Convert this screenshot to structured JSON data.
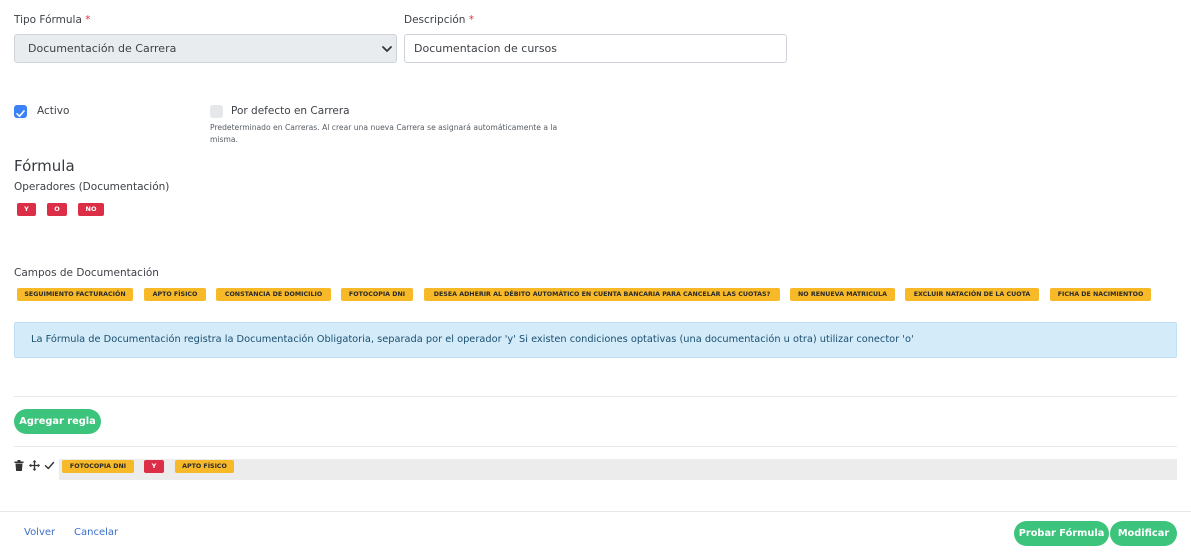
{
  "form": {
    "tipo_label": "Tipo Fórmula",
    "tipo_value": "Documentación de Carrera",
    "descripcion_label": "Descripción",
    "descripcion_value": "Documentacion de cursos",
    "required_mark": "*"
  },
  "options": {
    "activo_label": "Activo",
    "activo_checked": true,
    "por_defecto_label": "Por defecto en Carrera",
    "por_defecto_checked": false,
    "por_defecto_help_1": "Predeterminado en Carreras. Al crear una nueva Carrera se asignará automáticamente a la",
    "por_defecto_help_2": "misma."
  },
  "formula": {
    "heading": "Fórmula",
    "operators_label": "Operadores (Documentación)",
    "operators": [
      "Y",
      "O",
      "NO"
    ],
    "fields_label": "Campos de Documentación",
    "fields": [
      "SEGUIMIENTO FACTURACIÓN",
      "APTO FÍSICO",
      "CONSTANCIA DE DOMICILIO",
      "FOTOCOPIA DNI",
      "DESEA ADHERIR AL DÉBITO AUTOMÁTICO EN CUENTA BANCARIA PARA CANCELAR LAS CUOTAS?",
      "NO RENUEVA MATRICULA",
      "EXCLUIR NATACIÓN DE LA CUOTA",
      "FICHA DE NACIMIENTOO"
    ],
    "info_text": "La Fórmula de Documentación registra la Documentación Obligatoria, separada por el operador 'y' Si existen condiciones optativas (una documentación u otra) utilizar conector 'o'"
  },
  "rules": {
    "add_button": "Agregar regla",
    "rule_tokens": [
      {
        "text": "FOTOCOPIA DNI",
        "kind": "field"
      },
      {
        "text": "Y",
        "kind": "operator"
      },
      {
        "text": "APTO FÍSICO",
        "kind": "field"
      }
    ],
    "icons": [
      "trash-icon",
      "move-icon",
      "check-icon"
    ]
  },
  "footer": {
    "volver": "Volver",
    "cancelar": "Cancelar",
    "probar": "Probar Fórmula",
    "modificar": "Modificar"
  },
  "colors": {
    "operator": "#dc2e46",
    "field": "#f7b928",
    "accent_green": "#3cc47c",
    "checkbox_on": "#3b82f6",
    "info_bg": "#d4ecfa"
  }
}
